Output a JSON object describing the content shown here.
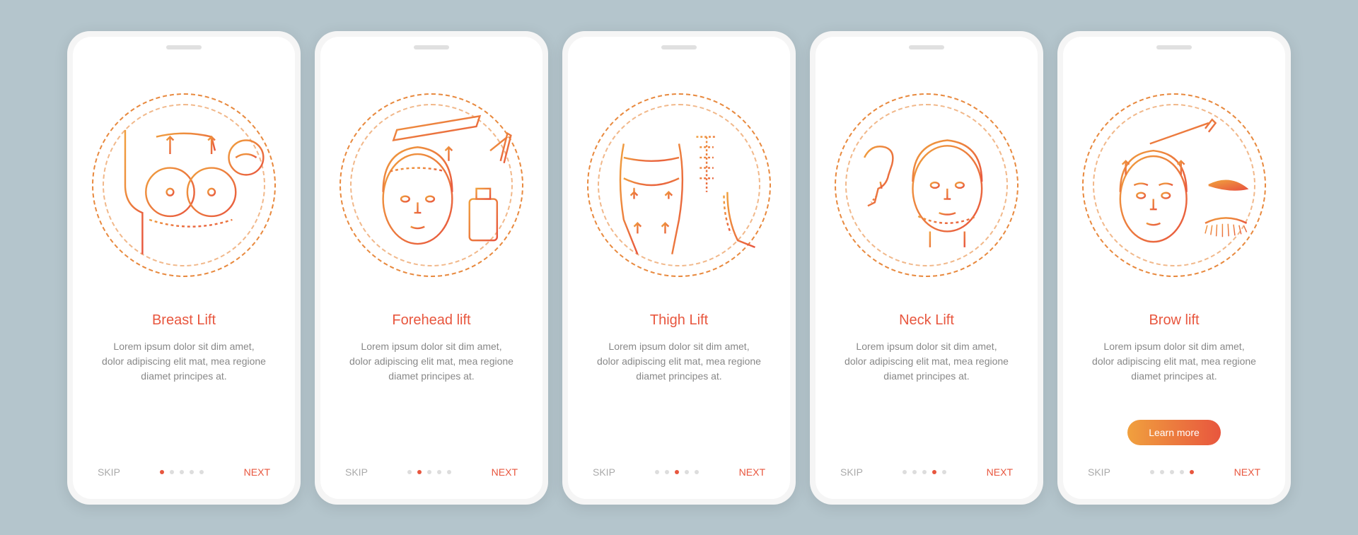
{
  "common": {
    "skip": "SKIP",
    "next": "NEXT",
    "description": "Lorem ipsum dolor sit dim amet, dolor adipiscing elit mat, mea regione diamet principes at.",
    "total_dots": 5
  },
  "screens": [
    {
      "title": "Breast Lift",
      "icon": "breast-lift-icon",
      "active_dot": 0,
      "has_cta": false
    },
    {
      "title": "Forehead lift",
      "icon": "forehead-lift-icon",
      "active_dot": 1,
      "has_cta": false
    },
    {
      "title": "Thigh Lift",
      "icon": "thigh-lift-icon",
      "active_dot": 2,
      "has_cta": false
    },
    {
      "title": "Neck Lift",
      "icon": "neck-lift-icon",
      "active_dot": 3,
      "has_cta": false
    },
    {
      "title": "Brow lift",
      "icon": "brow-lift-icon",
      "active_dot": 4,
      "has_cta": true,
      "cta_label": "Learn more"
    }
  ]
}
